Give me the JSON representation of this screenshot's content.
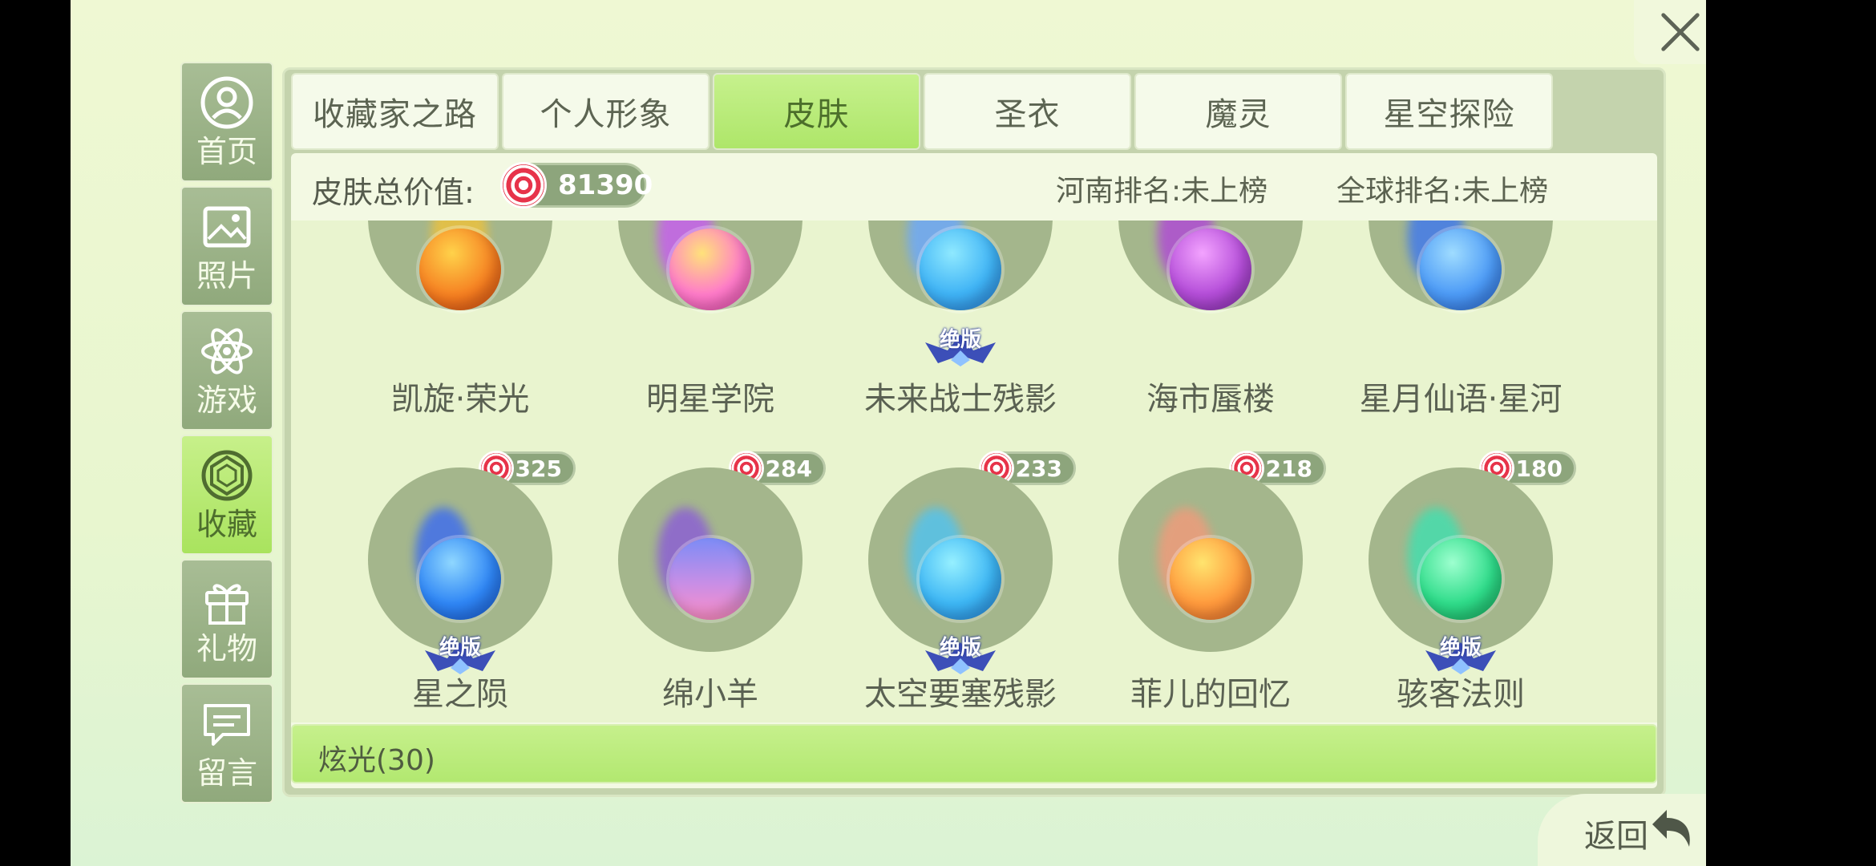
{
  "sidebar": {
    "items": [
      {
        "label": "首页",
        "icon": "profile-icon",
        "active": false
      },
      {
        "label": "照片",
        "icon": "photo-icon",
        "active": false
      },
      {
        "label": "游戏",
        "icon": "atom-icon",
        "active": false
      },
      {
        "label": "收藏",
        "icon": "gem-icon",
        "active": true
      },
      {
        "label": "礼物",
        "icon": "gift-icon",
        "active": false
      },
      {
        "label": "留言",
        "icon": "message-icon",
        "active": false
      }
    ]
  },
  "tabs": [
    {
      "label": "收藏家之路",
      "active": false
    },
    {
      "label": "个人形象",
      "active": false
    },
    {
      "label": "皮肤",
      "active": true
    },
    {
      "label": "圣衣",
      "active": false
    },
    {
      "label": "魔灵",
      "active": false
    },
    {
      "label": "星空探险",
      "active": false
    }
  ],
  "summary": {
    "total_label": "皮肤总价值:",
    "total_value": "81390",
    "henan_rank": "河南排名:未上榜",
    "global_rank": "全球排名:未上榜"
  },
  "skins_row1": [
    {
      "name": "凯旋·荣光",
      "orb": "orange-orb"
    },
    {
      "name": "明星学院",
      "orb": "pink-orb"
    },
    {
      "name": "未来战士残影",
      "orb": "blue-orb",
      "badge": "绝版"
    },
    {
      "name": "海市蜃楼",
      "orb": "purple-orb"
    },
    {
      "name": "星月仙语·星河",
      "orb": "blue-orb"
    }
  ],
  "skins_row2": [
    {
      "name": "星之陨",
      "price": "325",
      "orb": "blue-orb",
      "badge": "绝版"
    },
    {
      "name": "绵小羊",
      "price": "284",
      "orb": "pink-blue-orb"
    },
    {
      "name": "太空要塞残影",
      "price": "233",
      "orb": "cyan-orb",
      "badge": "绝版"
    },
    {
      "name": "菲儿的回忆",
      "price": "218",
      "orb": "orange-orb"
    },
    {
      "name": "骇客法则",
      "price": "180",
      "orb": "green-orb",
      "badge": "绝版"
    }
  ],
  "section": {
    "title": "炫光(30)"
  },
  "footer": {
    "back_label": "返回"
  },
  "colors": {
    "accent": "#b2e870",
    "panel": "#c4d3ad",
    "disc": "#a4b68c"
  }
}
